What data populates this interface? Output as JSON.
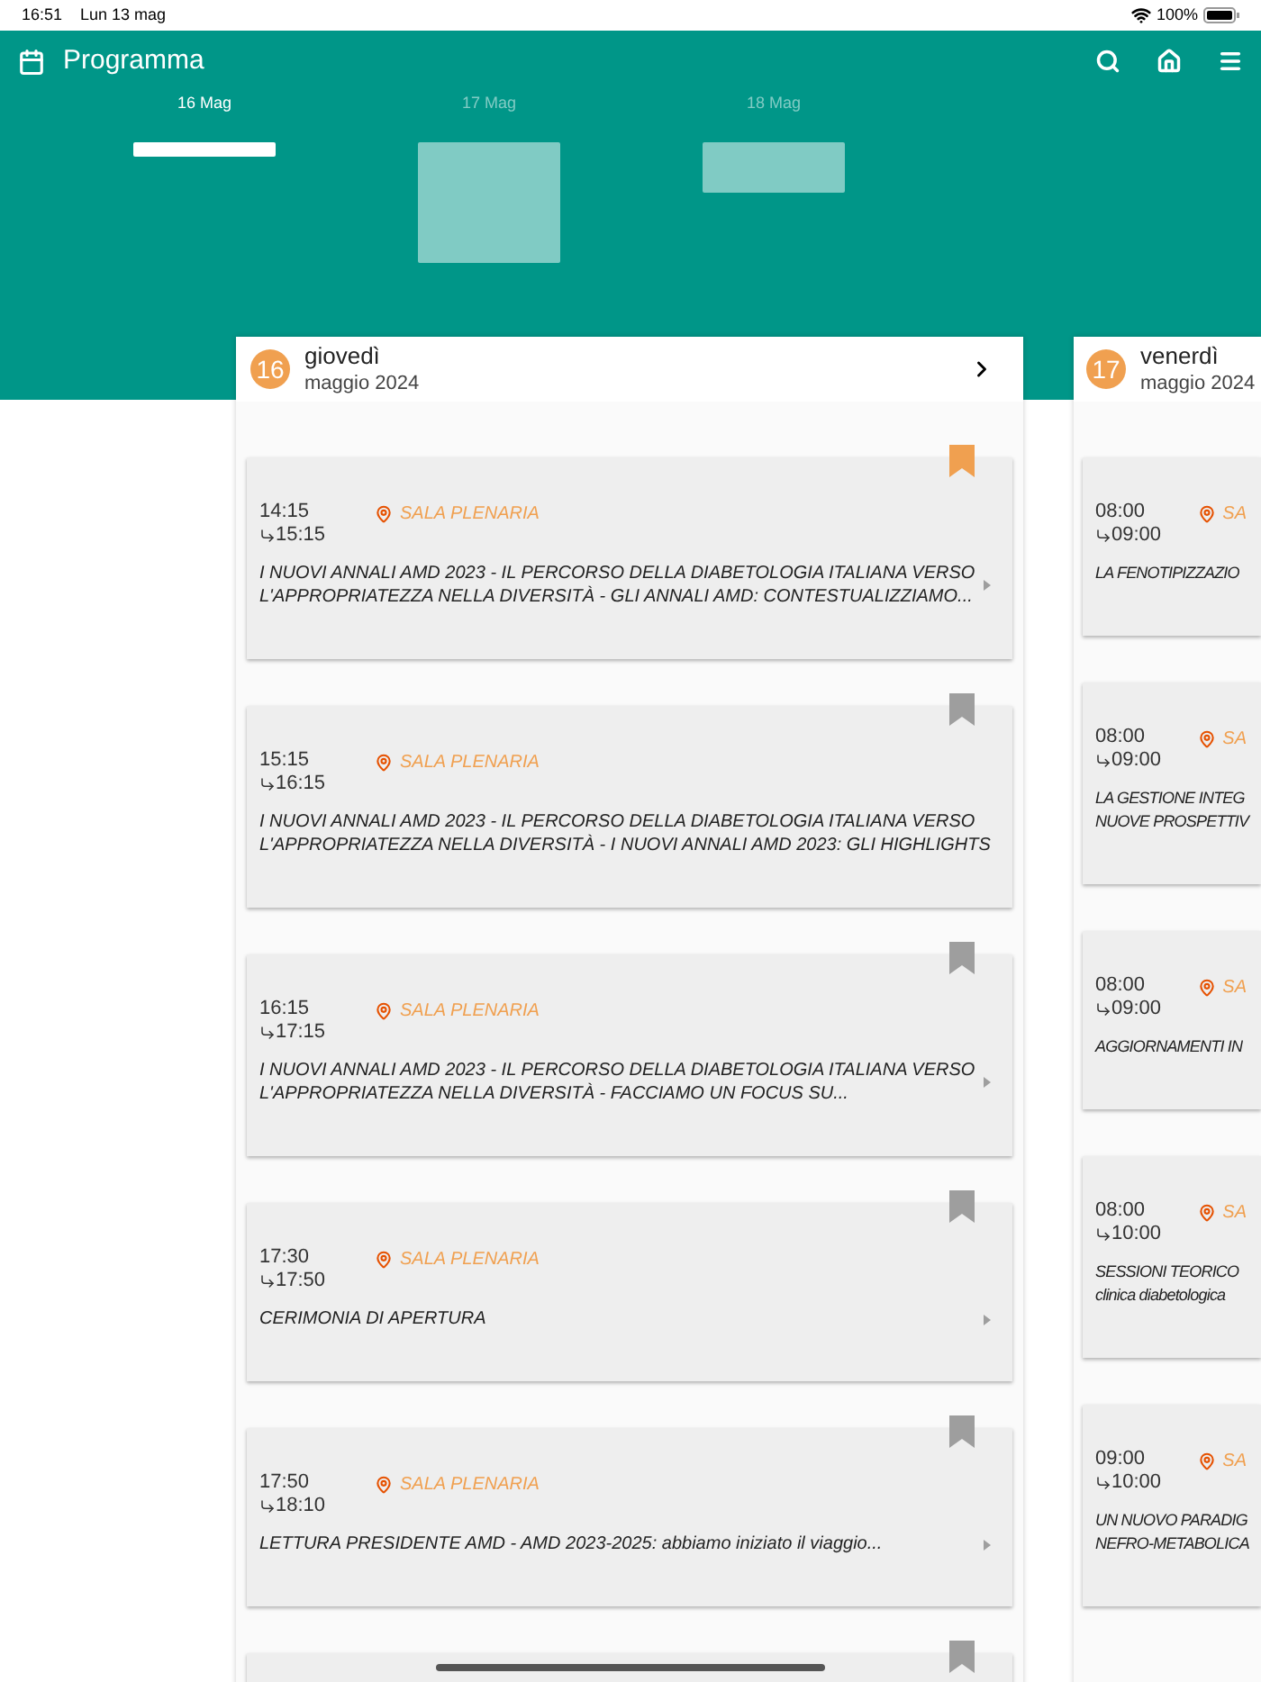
{
  "status_bar": {
    "time": "16:51",
    "date": "Lun 13 mag",
    "battery": "100%"
  },
  "app_bar": {
    "title": "Programma"
  },
  "tabs": [
    {
      "label": "16 Mag",
      "selected": true,
      "kind": "line"
    },
    {
      "label": "17 Mag",
      "selected": false,
      "kind": "square"
    },
    {
      "label": "18 Mag",
      "selected": false,
      "kind": "banner"
    }
  ],
  "days": [
    {
      "number": "16",
      "weekday": "giovedì",
      "month": "maggio 2024",
      "events": [
        {
          "start": "14:15",
          "end": "15:15",
          "room": "SALA PLENARIA",
          "title_lines": [
            "I NUOVI ANNALI AMD 2023 - IL PERCORSO DELLA DIABETOLOGIA ITALIANA VERSO",
            "L'APPROPRIATEZZA NELLA DIVERSITÀ - GLI ANNALI AMD: CONTESTUALIZZIAMO..."
          ],
          "bookmarked": true
        },
        {
          "start": "15:15",
          "end": "16:15",
          "room": "SALA PLENARIA",
          "title_lines": [
            "I NUOVI ANNALI AMD 2023 - IL PERCORSO DELLA DIABETOLOGIA ITALIANA VERSO",
            "L'APPROPRIATEZZA NELLA DIVERSITÀ - I NUOVI ANNALI AMD 2023: GLI HIGHLIGHTS"
          ],
          "bookmarked": false
        },
        {
          "start": "16:15",
          "end": "17:15",
          "room": "SALA PLENARIA",
          "title_lines": [
            "I NUOVI ANNALI AMD 2023 - IL PERCORSO DELLA DIABETOLOGIA ITALIANA VERSO",
            "L'APPROPRIATEZZA NELLA DIVERSITÀ - FACCIAMO UN FOCUS SU..."
          ],
          "bookmarked": false
        },
        {
          "start": "17:30",
          "end": "17:50",
          "room": "SALA PLENARIA",
          "title_lines": [
            "CERIMONIA DI APERTURA"
          ],
          "bookmarked": false
        },
        {
          "start": "17:50",
          "end": "18:10",
          "room": "SALA PLENARIA",
          "title_lines": [
            "LETTURA PRESIDENTE AMD - AMD 2023-2025: abbiamo iniziato il viaggio..."
          ],
          "bookmarked": false
        },
        {
          "bookmarked": false
        }
      ]
    },
    {
      "number": "17",
      "weekday": "venerdì",
      "month": "maggio 2024",
      "events": [
        {
          "start": "08:00",
          "end": "09:00",
          "room": "SA",
          "title_lines": [
            "LA FENOTIPIZZAZIO"
          ]
        },
        {
          "start": "08:00",
          "end": "09:00",
          "room": "SA",
          "title_lines": [
            "LA GESTIONE INTEG",
            "NUOVE PROSPETTIV"
          ]
        },
        {
          "start": "08:00",
          "end": "09:00",
          "room": "SA",
          "title_lines": [
            "AGGIORNAMENTI IN"
          ]
        },
        {
          "start": "08:00",
          "end": "10:00",
          "room": "SA",
          "title_lines": [
            "SESSIONI TEORICO",
            "clinica diabetologica"
          ]
        },
        {
          "start": "09:00",
          "end": "10:00",
          "room": "SA",
          "title_lines": [
            "UN NUOVO PARADIG",
            "NEFRO-METABOLICA"
          ]
        }
      ]
    }
  ]
}
